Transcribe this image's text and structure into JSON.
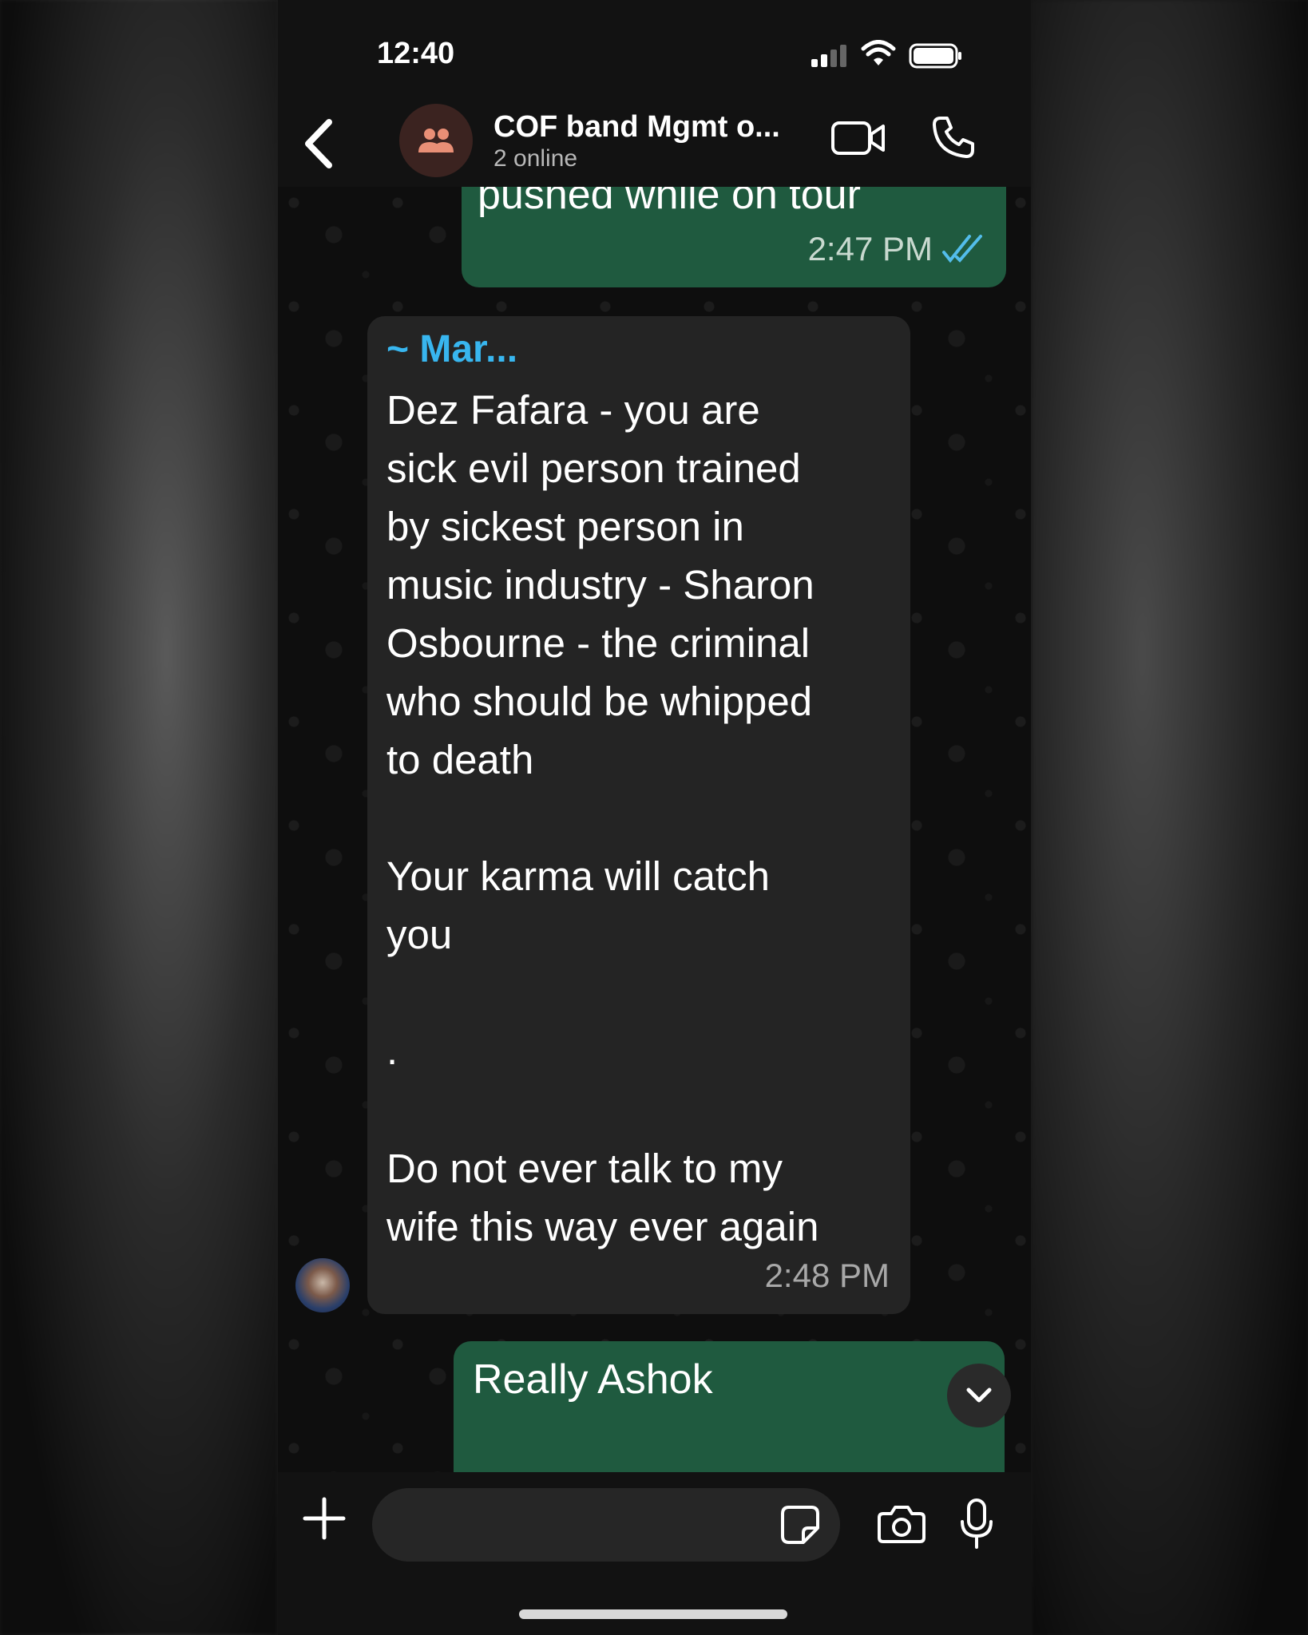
{
  "status_bar": {
    "time": "12:40"
  },
  "header": {
    "title": "COF band Mgmt o...",
    "subtitle": "2 online"
  },
  "messages": {
    "outgoing_top": {
      "text": "pushed while on tour",
      "time": "2:47 PM"
    },
    "incoming": {
      "sender": "~ Mar...",
      "lines": [
        "Dez Fafara - you are",
        "sick evil person trained",
        "by sickest person in",
        "music industry - Sharon",
        "Osbourne - the criminal",
        "who should be whipped",
        "to death",
        "Your karma will catch",
        "you",
        ".",
        "Do not ever talk to my",
        "wife this way ever again"
      ],
      "time": "2:48 PM"
    },
    "outgoing_bottom": {
      "text": "Really Ashok"
    }
  },
  "input": {
    "placeholder": ""
  },
  "colors": {
    "outgoing_bubble": "#1f5a3f",
    "incoming_bubble": "#242424",
    "sender_name": "#38b6ef",
    "read_ticks": "#53bdeb"
  }
}
